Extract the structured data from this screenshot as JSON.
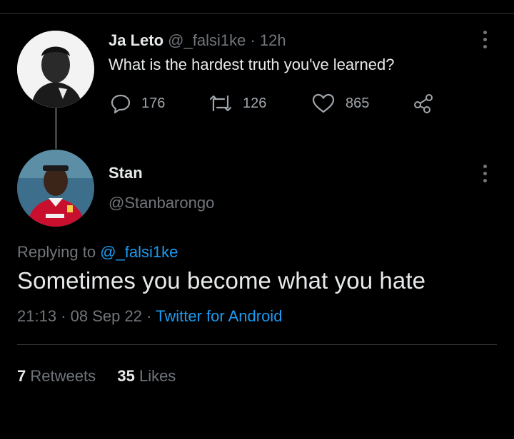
{
  "parent_tweet": {
    "author_name": "Ja Leto",
    "author_handle": "@_falsi1ke",
    "separator": "·",
    "time_ago": "12h",
    "text": "What is the hardest truth you've learned?",
    "replies": "176",
    "retweets": "126",
    "likes": "865"
  },
  "reply_tweet": {
    "author_name": "Stan",
    "author_handle": "@Stanbarongo",
    "replying_to_label": "Replying to",
    "replying_to_handle": "@_falsi1ke",
    "text": "Sometimes you become what you hate",
    "time": "21:13",
    "separator": "·",
    "date": "08 Sep 22",
    "client": "Twitter for Android",
    "retweet_count": "7",
    "retweet_label": "Retweets",
    "like_count": "35",
    "like_label": "Likes"
  },
  "colors": {
    "background": "#000000",
    "text": "#e7e9ea",
    "muted": "#71767b",
    "link": "#1d9bf0",
    "divider": "#2f3336"
  },
  "icons": {
    "reply": "comment-icon",
    "retweet": "retweet-icon",
    "like": "heart-icon",
    "share": "share-icon",
    "more": "more-vertical-icon"
  }
}
